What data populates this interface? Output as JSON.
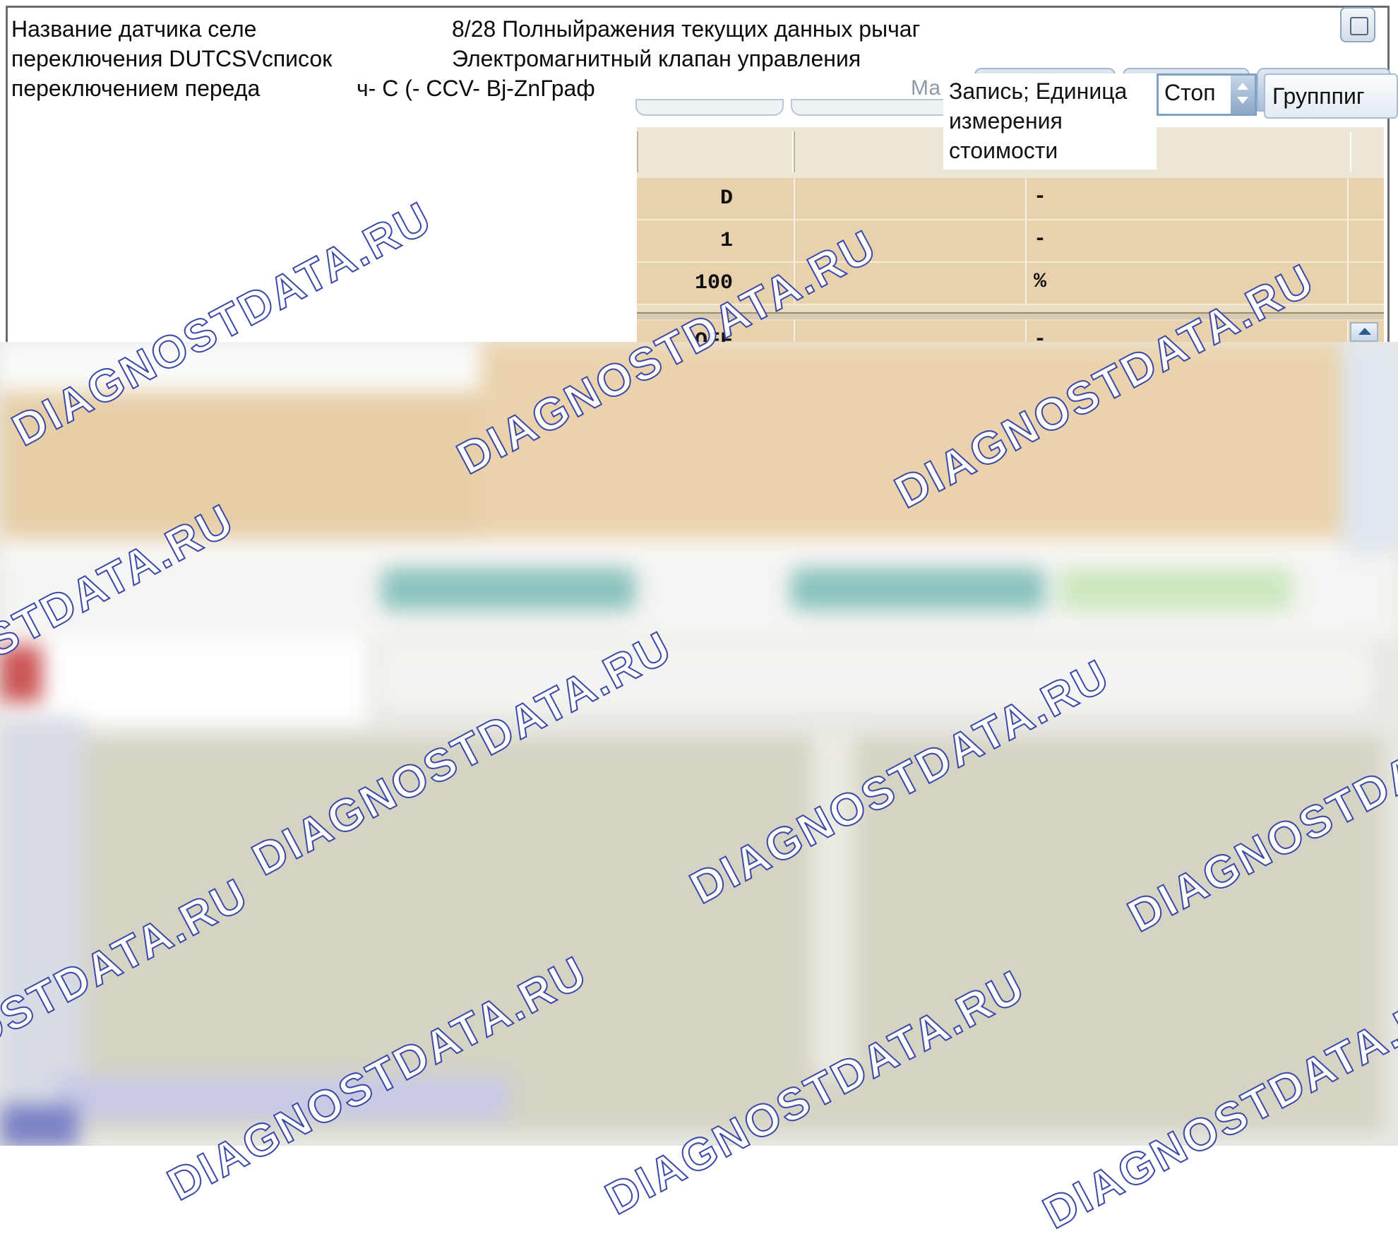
{
  "header": {
    "caption_parts": [
      "Название датчика селе",
      "переключения DUTCSV",
      "переключением переда",
      "8/28 Полный",
      "ражения текущих данных рычаг",
      "список",
      "Электромагнитный клапан управления",
      "ч- С (- ССV- Bj-Zn",
      "Граф"
    ]
  },
  "toolbar": {
    "tab_partial": "Ма",
    "popup_text": "Запись; Единица\nизмерения\nстоимости",
    "mode_value": "Стоп",
    "group_button_label": "Групппиг"
  },
  "grid": {
    "rows": [
      {
        "value": "D",
        "unit": "-"
      },
      {
        "value": "1",
        "unit": "-"
      },
      {
        "value": "100",
        "unit": "%"
      },
      {
        "value": "OFF",
        "unit": "-"
      }
    ]
  },
  "watermark": {
    "text_a": "DIAGNOSTDATA.RU"
  },
  "colors": {
    "grid_fill": "#e8d2ae",
    "accent_blue": "#7da2c4",
    "watermark_outline": "#3b48a8"
  }
}
